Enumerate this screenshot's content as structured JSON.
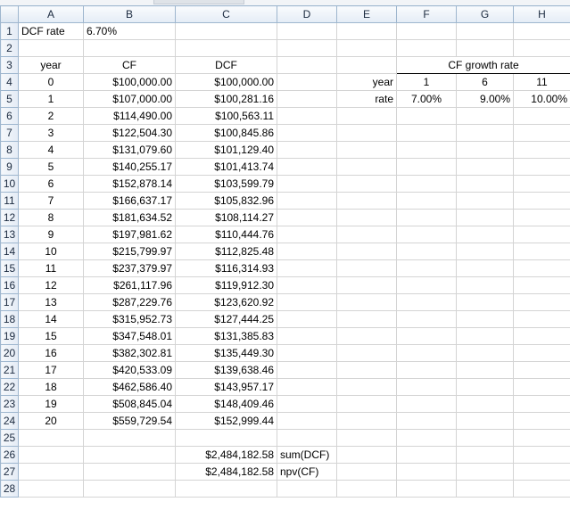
{
  "columns": [
    "A",
    "B",
    "C",
    "D",
    "E",
    "F",
    "G",
    "H"
  ],
  "cells": {
    "A1": "DCF rate",
    "B1": "6.70%",
    "A3": "year",
    "B3": "CF",
    "C3": "DCF",
    "F3": "CF growth rate",
    "E4": "year",
    "F4": "1",
    "G4": "6",
    "H4": "11",
    "E5": "rate",
    "F5": "7.00%",
    "G5": "9.00%",
    "H5": "10.00%",
    "C26": "$2,484,182.58",
    "D26": "sum(DCF)",
    "C27": "$2,484,182.58",
    "D27": "npv(CF)"
  },
  "cashflow_rows": [
    {
      "year": "0",
      "cf": "$100,000.00",
      "dcf": "$100,000.00"
    },
    {
      "year": "1",
      "cf": "$107,000.00",
      "dcf": "$100,281.16"
    },
    {
      "year": "2",
      "cf": "$114,490.00",
      "dcf": "$100,563.11"
    },
    {
      "year": "3",
      "cf": "$122,504.30",
      "dcf": "$100,845.86"
    },
    {
      "year": "4",
      "cf": "$131,079.60",
      "dcf": "$101,129.40"
    },
    {
      "year": "5",
      "cf": "$140,255.17",
      "dcf": "$101,413.74"
    },
    {
      "year": "6",
      "cf": "$152,878.14",
      "dcf": "$103,599.79"
    },
    {
      "year": "7",
      "cf": "$166,637.17",
      "dcf": "$105,832.96"
    },
    {
      "year": "8",
      "cf": "$181,634.52",
      "dcf": "$108,114.27"
    },
    {
      "year": "9",
      "cf": "$197,981.62",
      "dcf": "$110,444.76"
    },
    {
      "year": "10",
      "cf": "$215,799.97",
      "dcf": "$112,825.48"
    },
    {
      "year": "11",
      "cf": "$237,379.97",
      "dcf": "$116,314.93"
    },
    {
      "year": "12",
      "cf": "$261,117.96",
      "dcf": "$119,912.30"
    },
    {
      "year": "13",
      "cf": "$287,229.76",
      "dcf": "$123,620.92"
    },
    {
      "year": "14",
      "cf": "$315,952.73",
      "dcf": "$127,444.25"
    },
    {
      "year": "15",
      "cf": "$347,548.01",
      "dcf": "$131,385.83"
    },
    {
      "year": "16",
      "cf": "$382,302.81",
      "dcf": "$135,449.30"
    },
    {
      "year": "17",
      "cf": "$420,533.09",
      "dcf": "$139,638.46"
    },
    {
      "year": "18",
      "cf": "$462,586.40",
      "dcf": "$143,957.17"
    },
    {
      "year": "19",
      "cf": "$508,845.04",
      "dcf": "$148,409.46"
    },
    {
      "year": "20",
      "cf": "$559,729.54",
      "dcf": "$152,999.44"
    }
  ]
}
